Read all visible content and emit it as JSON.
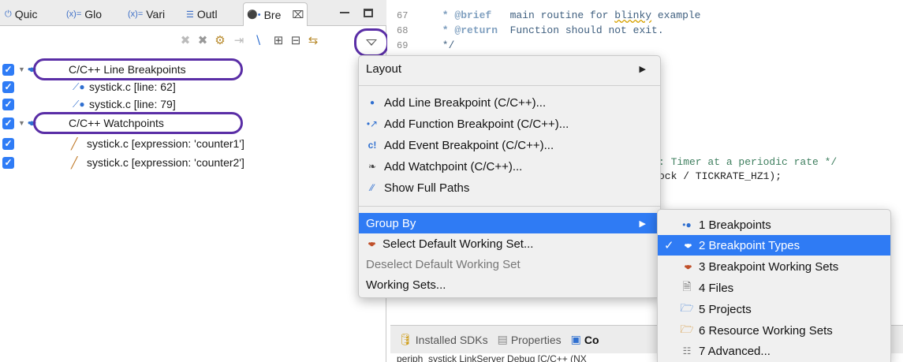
{
  "tabs": [
    {
      "label": "Quic",
      "icon": "quickstart-icon"
    },
    {
      "label": "Glo",
      "icon": "globals-icon"
    },
    {
      "label": "Vari",
      "icon": "variables-icon"
    },
    {
      "label": "Outl",
      "icon": "outline-icon"
    },
    {
      "label": "Bre",
      "icon": "breakpoints-icon",
      "active": true
    }
  ],
  "tree": [
    {
      "label": "C/C++ Line Breakpoints",
      "type": "group",
      "checked": true
    },
    {
      "label": "systick.c [line: 62]",
      "type": "line-breakpoint",
      "checked": true
    },
    {
      "label": "systick.c [line: 79]",
      "type": "line-breakpoint",
      "checked": true
    },
    {
      "label": "C/C++ Watchpoints",
      "type": "group",
      "checked": true
    },
    {
      "label": "systick.c [expression: 'counter1']",
      "type": "watchpoint",
      "checked": true
    },
    {
      "label": "systick.c [expression: 'counter2']",
      "type": "watchpoint",
      "checked": true
    }
  ],
  "editor": {
    "lines": [
      {
        "num": "67",
        "tag": " * @brief",
        "text": "   main routine for ",
        "squig": "blinky",
        "rest": " example"
      },
      {
        "num": "68",
        "tag": " * @return",
        "text": "  Function should not exit.",
        "squig": "",
        "rest": ""
      },
      {
        "num": "69",
        "tag": " */",
        "text": "",
        "squig": "",
        "rest": ""
      }
    ],
    "fragment1": ": Timer at a periodic rate */",
    "fragment2": "ock / TICKRATE_HZ1);"
  },
  "menu": {
    "layout": "Layout",
    "items": [
      {
        "label": "Add Line Breakpoint (C/C++)...",
        "icon": "line-breakpoint-icon"
      },
      {
        "label": "Add Function Breakpoint (C/C++)...",
        "icon": "function-breakpoint-icon"
      },
      {
        "label": "Add Event Breakpoint (C/C++)...",
        "icon": "event-breakpoint-icon"
      },
      {
        "label": "Add Watchpoint (C/C++)...",
        "icon": "watchpoint-icon"
      },
      {
        "label": "Show Full Paths",
        "icon": "show-paths-icon"
      }
    ],
    "group_by": "Group By",
    "select_ws": "Select Default Working Set...",
    "deselect_ws": "Deselect Default Working Set",
    "working_sets": "Working Sets..."
  },
  "submenu": {
    "items": [
      {
        "label": "1 Breakpoints",
        "icon": "breakpoints-icon"
      },
      {
        "label": "2 Breakpoint Types",
        "icon": "breakpoint-types-icon",
        "checked": true
      },
      {
        "label": "3 Breakpoint Working Sets",
        "icon": "working-sets-icon"
      },
      {
        "label": "4 Files",
        "icon": "file-icon"
      },
      {
        "label": "5 Projects",
        "icon": "project-folder-icon"
      },
      {
        "label": "6 Resource Working Sets",
        "icon": "resource-folder-icon"
      },
      {
        "label": "7 Advanced...",
        "icon": "advanced-icon"
      }
    ]
  },
  "bottom": {
    "tabs": [
      "Installed SDKs",
      "Properties",
      "Co"
    ],
    "status": "periph_systick LinkServer Debug [C/C++ (NX"
  },
  "colors": {
    "highlight": "#2f7bf4",
    "annotation": "#5a2ea6",
    "checkbox": "#2f7cf6"
  }
}
